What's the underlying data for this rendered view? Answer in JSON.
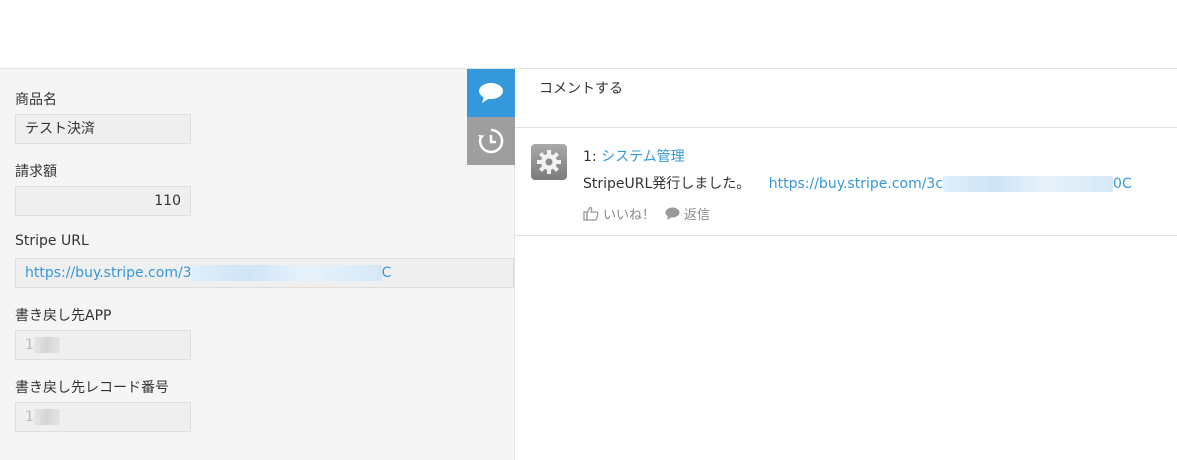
{
  "form": {
    "fields": [
      {
        "label": "商品名",
        "value": "テスト決済"
      },
      {
        "label": "請求額",
        "value": "110"
      },
      {
        "label": "Stripe URL",
        "value_start": "https://buy.stripe.com/3",
        "value_end": "C"
      },
      {
        "label": "書き戻し先APP",
        "value": "1"
      },
      {
        "label": "書き戻し先レコード番号",
        "value": "1"
      }
    ]
  },
  "comments": {
    "entry_placeholder": "コメントする",
    "items": [
      {
        "number": "1:",
        "author": "システム管理",
        "text": "StripeURL発行しました。",
        "link_start": "https://buy.stripe.com/3c",
        "link_end": "0C",
        "like_label": "いいね！",
        "reply_label": "返信"
      }
    ]
  },
  "icons": {
    "comment_tab": "speech-bubble-icon",
    "history_tab": "history-icon",
    "avatar": "gear-icon",
    "like": "thumbs-up-icon",
    "reply": "speech-bubble-icon"
  },
  "colors": {
    "accent": "#3498db",
    "history_tab": "#9e9e9e"
  }
}
